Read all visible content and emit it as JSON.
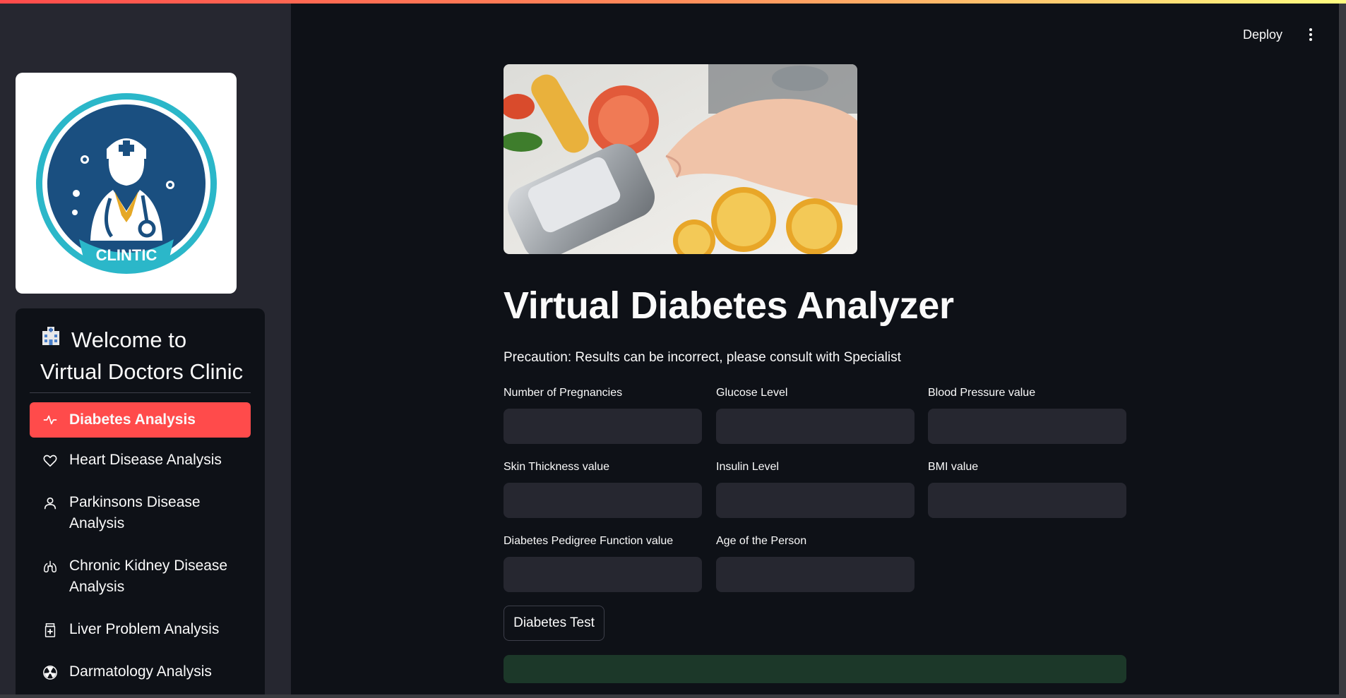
{
  "header": {
    "deploy_label": "Deploy",
    "menu_icon": "kebab-menu-icon"
  },
  "sidebar": {
    "logo_text": "CLINTIC",
    "welcome_line1": "Welcome to",
    "welcome_line2": "Virtual Doctors Clinic",
    "items": [
      {
        "label": "Diabetes Analysis",
        "icon": "activity-icon",
        "active": true
      },
      {
        "label": "Heart Disease Analysis",
        "icon": "heart-icon",
        "active": false
      },
      {
        "label": "Parkinsons Disease Analysis",
        "icon": "person-icon",
        "active": false
      },
      {
        "label": "Chronic Kidney Disease Analysis",
        "icon": "lungs-icon",
        "active": false
      },
      {
        "label": "Liver Problem Analysis",
        "icon": "medicine-bottle-icon",
        "active": false
      },
      {
        "label": "Darmatology Analysis",
        "icon": "radiation-icon",
        "active": false
      }
    ]
  },
  "main": {
    "title": "Virtual Diabetes Analyzer",
    "precaution": "Precaution: Results can be incorrect, please consult with Specialist",
    "fields": [
      {
        "label": "Number of Pregnancies",
        "value": ""
      },
      {
        "label": "Glucose Level",
        "value": ""
      },
      {
        "label": "Blood Pressure value",
        "value": ""
      },
      {
        "label": "Skin Thickness value",
        "value": ""
      },
      {
        "label": "Insulin Level",
        "value": ""
      },
      {
        "label": "BMI value",
        "value": ""
      },
      {
        "label": "Diabetes Pedigree Function value",
        "value": ""
      },
      {
        "label": "Age of the Person",
        "value": ""
      }
    ],
    "button_label": "Diabetes Test",
    "result_text": ""
  },
  "colors": {
    "accent": "#ff4b4b",
    "background": "#0e1117",
    "sidebar": "#262730",
    "success_bg": "#1c3829"
  }
}
